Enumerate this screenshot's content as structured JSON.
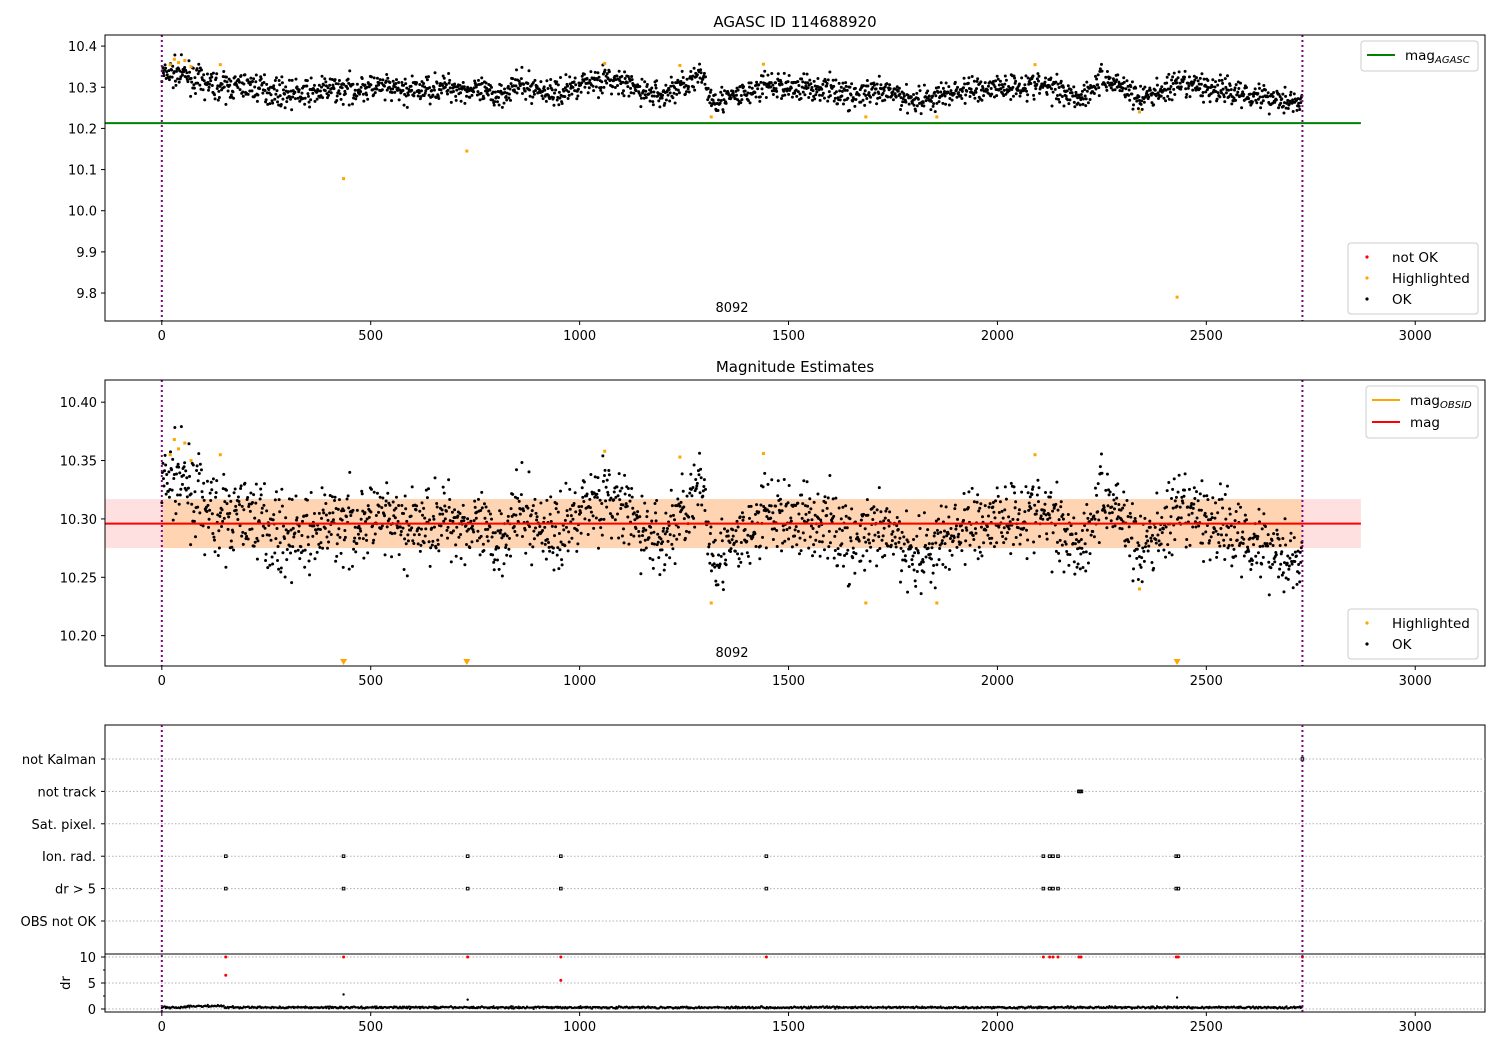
{
  "chart_data": [
    {
      "type": "scatter",
      "title": "AGASC ID 114688920",
      "xlim": [
        -136,
        3167
      ],
      "ylim": [
        9.732,
        10.427
      ],
      "xticks": [
        0,
        500,
        1000,
        1500,
        2000,
        2500,
        3000
      ],
      "yticks": [
        9.8,
        9.9,
        10.0,
        10.1,
        10.2,
        10.3,
        10.4
      ],
      "annotation": "8092",
      "vlines": [
        0,
        2730
      ],
      "hline": {
        "name": "mag_AGASC",
        "label_main": "mag",
        "label_sub": "AGASC",
        "value": 10.213,
        "color": "#008000"
      },
      "legend_top": [
        {
          "label": "mag",
          "sub": "AGASC",
          "color": "#008000"
        }
      ],
      "legend_bottom": [
        {
          "label": "not OK",
          "color": "#ff0000"
        },
        {
          "label": "Highlighted",
          "color": "#ffa500"
        },
        {
          "label": "OK",
          "color": "#000000"
        }
      ],
      "legend_placement": [
        "top-right",
        "bottom-right"
      ]
    },
    {
      "type": "scatter",
      "title": "Magnitude Estimates",
      "xlim": [
        -136,
        3167
      ],
      "ylim": [
        10.174,
        10.419
      ],
      "xticks": [
        0,
        500,
        1000,
        1500,
        2000,
        2500,
        3000
      ],
      "yticks": [
        10.2,
        10.25,
        10.3,
        10.35,
        10.4
      ],
      "annotation": "8092",
      "vlines": [
        0,
        2730
      ],
      "mag": 10.296,
      "mag_band": [
        10.275,
        10.317
      ],
      "legend_top": [
        {
          "label": "mag",
          "sub": "OBSID",
          "color": "#ffa500"
        },
        {
          "label": "mag",
          "sub": "",
          "color": "#ff0000"
        }
      ],
      "legend_bottom": [
        {
          "label": "Highlighted",
          "color": "#ffa500"
        },
        {
          "label": "OK",
          "color": "#000000"
        }
      ],
      "legend_placement": [
        "top-right",
        "bottom-right"
      ]
    },
    {
      "type": "scatter",
      "title": "",
      "categories": [
        "not Kalman",
        "not track",
        "Sat. pixel.",
        "Ion. rad.",
        "dr > 5",
        "OBS not OK"
      ],
      "flags": {
        "not Kalman": [
          2730
        ],
        "not track": [
          2195,
          2198,
          2201
        ],
        "Sat. pixel.": [],
        "Ion. rad.": [
          153,
          435,
          732,
          955,
          1447,
          2110,
          2125,
          2133,
          2145,
          2428,
          2433
        ],
        "dr > 5": [
          153,
          435,
          732,
          955,
          1447,
          2110,
          2125,
          2133,
          2145,
          2428,
          2433
        ],
        "OBS not OK": []
      },
      "xlim": [
        -136,
        3167
      ],
      "vlines": [
        0,
        2730
      ]
    },
    {
      "type": "scatter",
      "ylabel": "dr",
      "xlim": [
        -136,
        3167
      ],
      "ylim": [
        -1,
        10.5
      ],
      "yticks": [
        0,
        5,
        10
      ],
      "xticks": [
        0,
        500,
        1000,
        1500,
        2000,
        2500,
        3000
      ],
      "dr_not_ok": {
        "x": [
          153,
          153,
          435,
          732,
          955,
          955,
          1447,
          2110,
          2125,
          2133,
          2145,
          2195,
          2200,
          2428,
          2433,
          2730
        ],
        "y": [
          10,
          6.5,
          10,
          10,
          10,
          5.5,
          10,
          10,
          10,
          10,
          10,
          10,
          10,
          10,
          10,
          10
        ]
      },
      "dr_ok_outliers": {
        "x": [
          435,
          732,
          2430
        ],
        "y": [
          2.8,
          1.8,
          2.2
        ]
      },
      "dr_typical": 0.3
    }
  ],
  "series": {
    "ok_trend": {
      "x": [
        0,
        30,
        60,
        100,
        150,
        200,
        250,
        300,
        350,
        400,
        450,
        500,
        550,
        600,
        650,
        700,
        750,
        800,
        850,
        900,
        950,
        1000,
        1050,
        1100,
        1150,
        1200,
        1250,
        1300,
        1310,
        1350,
        1400,
        1450,
        1500,
        1550,
        1600,
        1650,
        1700,
        1750,
        1800,
        1850,
        1900,
        1950,
        2000,
        2050,
        2100,
        2150,
        2200,
        2250,
        2300,
        2340,
        2400,
        2450,
        2500,
        2550,
        2600,
        2650,
        2700,
        2730
      ],
      "mag": [
        10.33,
        10.335,
        10.33,
        10.31,
        10.3,
        10.305,
        10.295,
        10.285,
        10.285,
        10.295,
        10.295,
        10.3,
        10.295,
        10.29,
        10.3,
        10.3,
        10.29,
        10.28,
        10.305,
        10.295,
        10.285,
        10.31,
        10.32,
        10.31,
        10.29,
        10.28,
        10.31,
        10.325,
        10.275,
        10.27,
        10.285,
        10.305,
        10.3,
        10.3,
        10.295,
        10.28,
        10.285,
        10.285,
        10.27,
        10.275,
        10.29,
        10.295,
        10.3,
        10.305,
        10.305,
        10.295,
        10.275,
        10.32,
        10.305,
        10.27,
        10.295,
        10.305,
        10.3,
        10.29,
        10.285,
        10.275,
        10.27,
        10.26
      ]
    },
    "highlighted": {
      "x": [
        20,
        30,
        40,
        55,
        70,
        140,
        435,
        730,
        1060,
        1240,
        1315,
        1440,
        1685,
        1855,
        2090,
        2340,
        2430
      ],
      "mag": [
        10.355,
        10.368,
        10.36,
        10.365,
        10.35,
        10.355,
        10.078,
        10.145,
        10.358,
        10.353,
        10.228,
        10.356,
        10.228,
        10.228,
        10.355,
        10.24,
        9.79
      ]
    }
  }
}
